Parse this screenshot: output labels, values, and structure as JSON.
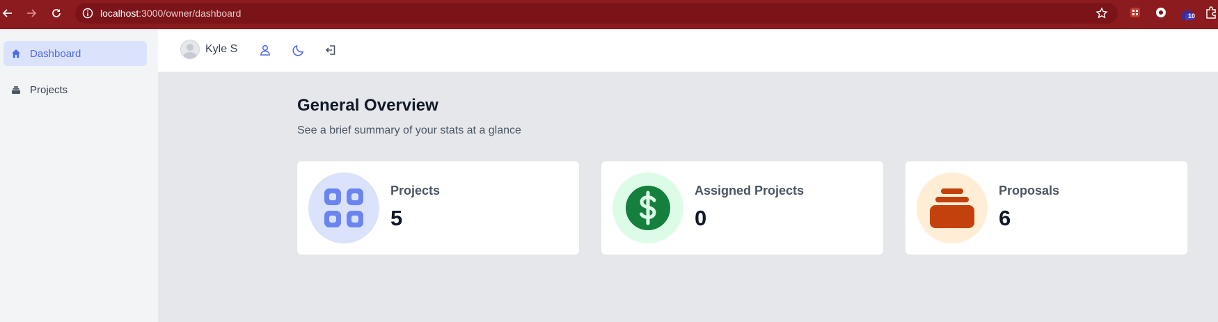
{
  "browser": {
    "url_host": "localhost",
    "url_rest": ":3000/owner/dashboard",
    "badge_count": "10"
  },
  "sidebar": {
    "items": [
      {
        "label": "Dashboard",
        "icon": "home-icon",
        "active": true
      },
      {
        "label": "Projects",
        "icon": "inbox-stack-icon",
        "active": false
      }
    ]
  },
  "header": {
    "user_name": "Kyle S",
    "icons": [
      "user-icon",
      "moon-icon",
      "logout-icon"
    ]
  },
  "main": {
    "title": "General Overview",
    "subtitle": "See a brief summary of your stats at a glance",
    "cards": [
      {
        "label": "Projects",
        "value": "5",
        "icon": "grid-icon",
        "circle_color": "#dbe2fb",
        "icon_color": "#6b85ee"
      },
      {
        "label": "Assigned Projects",
        "value": "0",
        "icon": "dollar-icon",
        "circle_color": "#dcfce7",
        "icon_color": "#15803d"
      },
      {
        "label": "Proposals",
        "value": "6",
        "icon": "stack-icon",
        "circle_color": "#ffedd5",
        "icon_color": "#c2410c"
      }
    ]
  }
}
